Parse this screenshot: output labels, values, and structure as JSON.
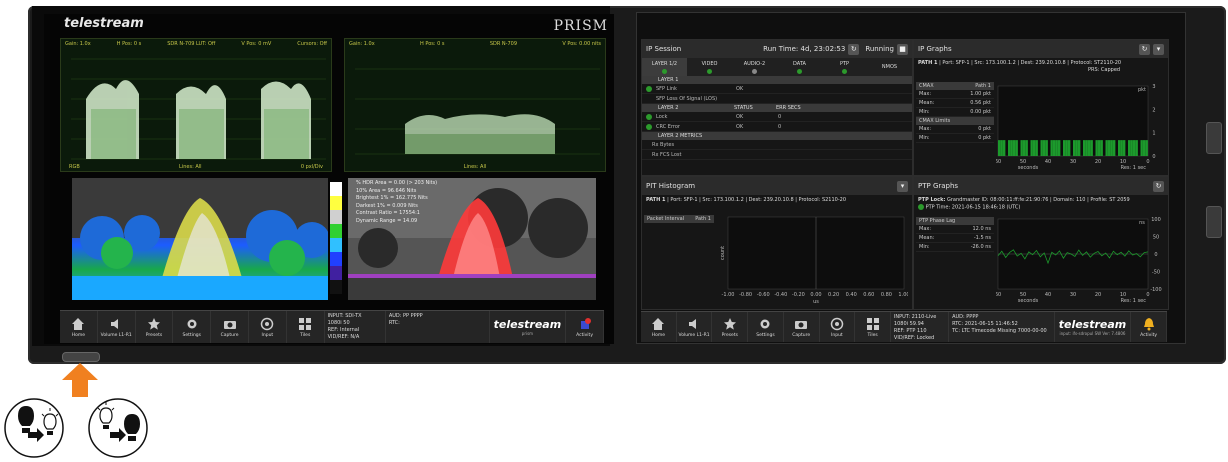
{
  "left_screen": {
    "logo": "telestream",
    "brand": "PRISM",
    "wf1": {
      "header": [
        "Gain: 1.0x",
        "H Pos: 0 s",
        "SDR N-709 LUT: Off",
        "V Pos: 0 mV",
        "Cursors: Off"
      ],
      "footer": [
        "RGB",
        "Lines: All",
        "0 pxl/Div"
      ]
    },
    "wf2": {
      "header": [
        "Gain: 1.0x",
        "H Pos: 0 s",
        "SDR N-709",
        "V Pos: 0.00 nits"
      ],
      "footer": [
        "Lines: All"
      ]
    },
    "hdr_stats": [
      {
        "label": "% HDR Area",
        "value": "= 0.00 (> 203 Nits)"
      },
      {
        "label": "10% Area",
        "value": "= 96.646 Nits"
      },
      {
        "label": "Brightest 1%",
        "value": "= 162.775 Nits"
      },
      {
        "label": "Darkest 1%",
        "value": "= 0.009 Nits"
      },
      {
        "label": "Contrast Ratio",
        "value": "= 17554:1"
      },
      {
        "label": "Dynamic Range",
        "value": "= 14.09"
      }
    ],
    "toolbar": [
      {
        "label": "Home",
        "icon": "home-icon"
      },
      {
        "label": "Volume L1-R1",
        "icon": "volume-icon"
      },
      {
        "label": "Presets",
        "icon": "star-icon"
      },
      {
        "label": "Settings",
        "icon": "gear-icon"
      },
      {
        "label": "Capture",
        "icon": "camera-icon"
      },
      {
        "label": "Input",
        "icon": "input-icon"
      },
      {
        "label": "Tiles",
        "icon": "tiles-icon"
      }
    ],
    "status1": [
      "INPUT: SDI-TX",
      "1080i 50",
      "REF: Internal",
      "VID/REF: N/A"
    ],
    "status2": [
      "AUD: PP PPPP",
      "RTC:"
    ],
    "ts_logo": "telestream",
    "ts_sub": "prism",
    "activity_label": "Activity"
  },
  "right_screen": {
    "ip_session": {
      "title": "IP Session",
      "run_time": "Run Time: 4d, 23:02:53",
      "state": "Running",
      "tabs": [
        {
          "label": "LAYER 1/2",
          "status": "ok"
        },
        {
          "label": "VIDEO",
          "status": "ok"
        },
        {
          "label": "AUDIO-2",
          "status": "grey"
        },
        {
          "label": "DATA",
          "status": "ok"
        },
        {
          "label": "PTP",
          "status": "ok"
        },
        {
          "label": "NMOS",
          "status": "none"
        }
      ],
      "layer1_header": "LAYER 1",
      "layer1_rows": [
        {
          "name": "SFP Link",
          "status": "OK",
          "err": ""
        },
        {
          "name": "SFP Loss Of Signal (LOS)",
          "status": "",
          "err": ""
        }
      ],
      "layer2_header": [
        "LAYER 2",
        "STATUS",
        "ERR SECS"
      ],
      "layer2_rows": [
        {
          "name": "Lock",
          "status": "OK",
          "err": "0"
        },
        {
          "name": "CRC Error",
          "status": "OK",
          "err": "0"
        }
      ],
      "metrics_header": "LAYER 2 METRICS",
      "metrics_rows": [
        "Rx Bytes",
        "Rx FCS Lost"
      ]
    },
    "ip_graphs": {
      "title": "IP Graphs",
      "path": "PATH 1",
      "port": "Port: SFP-1",
      "src": "Src: 173.100.1.2",
      "dest": "Dest: 239.20.10.8",
      "protocol": "Protocol: ST2110-20",
      "prs": "PRS: Capped",
      "box_title": "CMAX",
      "box_path": "Path 1",
      "box_rows": [
        [
          "Max:",
          "1.00 pkt"
        ],
        [
          "Mean:",
          "0.56 pkt"
        ],
        [
          "Min:",
          "0.00 pkt"
        ]
      ],
      "limits_title": "CMAX Limits",
      "limit_rows": [
        [
          "Max:",
          "0 pkt"
        ],
        [
          "Min:",
          "0 pkt"
        ]
      ],
      "x_ticks": [
        "60",
        "50",
        "40",
        "30",
        "20",
        "10",
        "0"
      ],
      "x_label": "seconds",
      "res": "Res: 1 sec",
      "y_unit": "pkt",
      "y_ticks": [
        "3",
        "2",
        "1",
        "0"
      ],
      "bars": [
        1,
        1,
        1,
        0,
        1,
        1,
        1,
        1,
        0,
        1,
        1,
        1,
        0,
        1,
        1,
        1,
        0,
        1,
        1,
        1,
        0,
        1,
        1,
        1,
        1,
        0,
        1,
        1,
        1,
        0,
        1,
        1,
        1,
        0,
        1,
        1,
        1,
        1,
        0,
        1,
        1,
        1,
        0,
        1,
        1,
        1,
        1,
        0,
        1,
        1,
        1,
        0,
        1,
        1,
        1,
        1,
        0,
        1,
        1,
        1
      ]
    },
    "pit": {
      "title": "PIT Histogram",
      "path": "PATH 1",
      "port": "Port: SFP-1",
      "src": "Src: 173.100.1.2",
      "dest": "Dest: 239.20.10.8",
      "protocol": "Protocol: S2110-20",
      "box_title": "Packet Interval",
      "box_path": "Path 1",
      "x_ticks": [
        "-1.00",
        "-0.80",
        "-0.60",
        "-0.40",
        "-0.20",
        "0.00",
        "0.20",
        "0.40",
        "0.60",
        "0.80",
        "1.00"
      ],
      "x_label": "us",
      "y_label": "count"
    },
    "ptp": {
      "title": "PTP Graphs",
      "lock": "PTP Lock:",
      "gm": "Grandmaster ID: 08:00:11:ff:fe:21:90:76",
      "domain": "Domain: 110",
      "profile": "Profile: ST 2059",
      "time": "PTP Time: 2021-06-15 18:46:18 (UTC)",
      "box_title": "PTP Phase Lag",
      "rows": [
        [
          "Max:",
          "12.0 ns"
        ],
        [
          "Mean:",
          "-1.5 ns"
        ],
        [
          "Min:",
          "-26.0 ns"
        ]
      ],
      "y_unit": "ns",
      "y_ticks": [
        "100",
        "50",
        "0",
        "-50",
        "-100"
      ],
      "x_ticks": [
        "60",
        "50",
        "40",
        "30",
        "20",
        "10",
        "0"
      ],
      "x_label": "seconds",
      "res": "Res: 1 sec"
    },
    "toolbar": [
      {
        "label": "Home",
        "icon": "home-icon"
      },
      {
        "label": "Volume L1-R1",
        "icon": "volume-icon"
      },
      {
        "label": "Presets",
        "icon": "star-icon"
      },
      {
        "label": "Settings",
        "icon": "gear-icon"
      },
      {
        "label": "Capture",
        "icon": "camera-icon"
      },
      {
        "label": "Input",
        "icon": "input-icon"
      },
      {
        "label": "Tiles",
        "icon": "tiles-icon"
      }
    ],
    "status1": [
      "INPUT: 2110-Live",
      "1080i 59.94",
      "REF: PTP 110",
      "VID/REF: Locked"
    ],
    "status2": [
      "AUD: PPPP",
      "RTC: 2021-06-15 11:46:52",
      "TC: LTC Timecode Missing 7000-00-00"
    ],
    "ts_logo": "telestream",
    "ts_sub": "input: ifs-sdropul  SW Ver: 7.4806",
    "activity_label": "Activity"
  },
  "colors": {
    "accent": "#f08020",
    "ok": "#2c9a2c",
    "graph": "#1c9a2c"
  }
}
